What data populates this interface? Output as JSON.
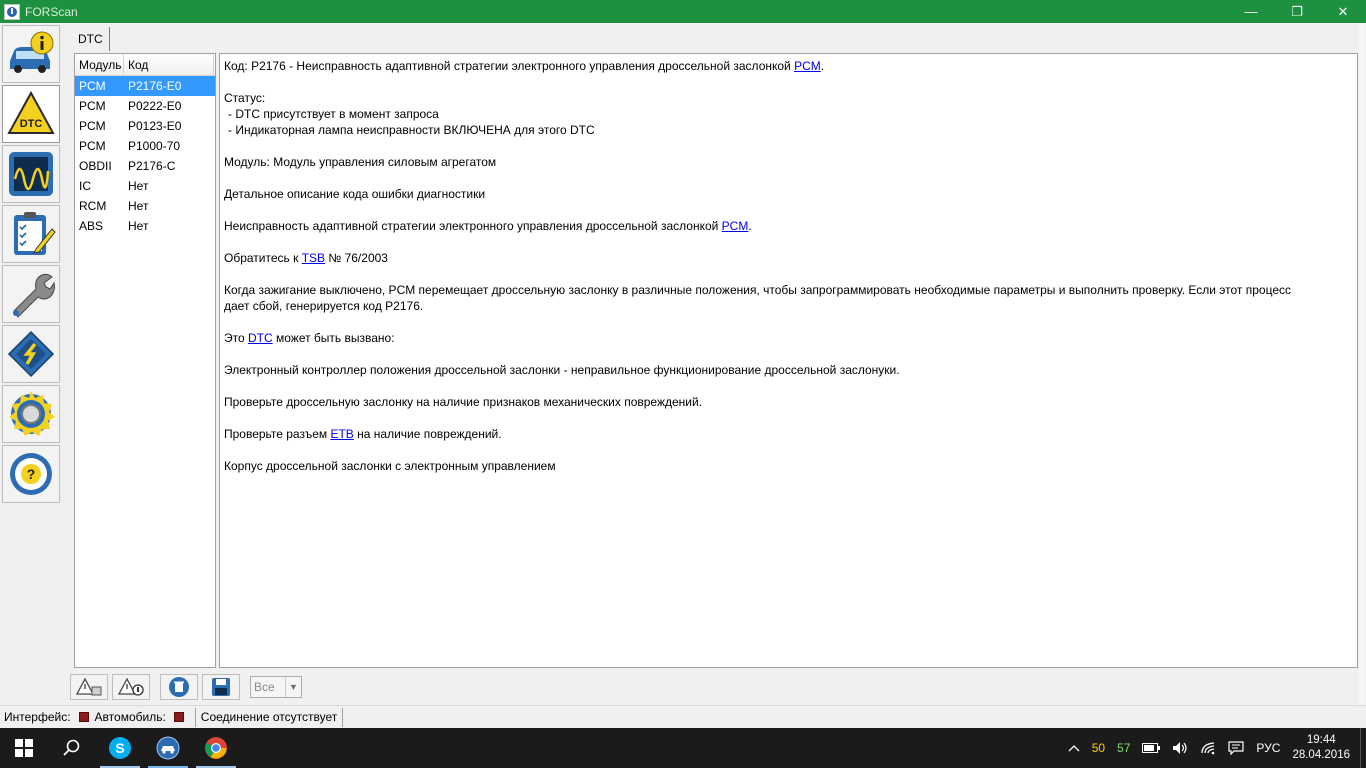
{
  "window": {
    "title": "FORScan",
    "minimize": "—",
    "maximize": "❐",
    "close": "✕"
  },
  "sidebar": {
    "items": [
      {
        "name": "vehicle-info",
        "icon": "car-info-icon"
      },
      {
        "name": "dtc",
        "icon": "dtc-warning-icon",
        "label": "DTC"
      },
      {
        "name": "oscilloscope",
        "icon": "oscilloscope-icon"
      },
      {
        "name": "tests",
        "icon": "checklist-icon"
      },
      {
        "name": "service",
        "icon": "wrench-icon"
      },
      {
        "name": "configuration",
        "icon": "chip-icon"
      },
      {
        "name": "settings",
        "icon": "gear-icon"
      },
      {
        "name": "help",
        "icon": "steering-help-icon"
      }
    ]
  },
  "tabs": [
    {
      "label": "DTC"
    }
  ],
  "dtc_table": {
    "headers": {
      "module": "Модуль",
      "code": "Код"
    },
    "rows": [
      {
        "module": "PCM",
        "code": "P2176-E0"
      },
      {
        "module": "PCM",
        "code": "P0222-E0"
      },
      {
        "module": "PCM",
        "code": "P0123-E0"
      },
      {
        "module": "PCM",
        "code": "P1000-70"
      },
      {
        "module": "OBDII",
        "code": "P2176-C"
      },
      {
        "module": "IC",
        "code": "Нет"
      },
      {
        "module": "RCM",
        "code": "Нет"
      },
      {
        "module": "ABS",
        "code": "Нет"
      }
    ],
    "selected_index": 0
  },
  "details": {
    "code_prefix": "Код: P2176 - Неисправность адаптивной стратегии электронного управления дроссельной заслонкой ",
    "code_link": "PCM",
    "code_suffix": ".",
    "status_label": "Статус:",
    "status_1": " - DTC присутствует в момент запроса",
    "status_2": " - Индикаторная лампа неисправности ВКЛЮЧЕНА для этого DTC",
    "module": "Модуль: Модуль управления силовым агрегатом",
    "detail_heading": "Детальное описание кода ошибки диагностики",
    "fault_prefix": "Неисправность адаптивной стратегии электронного управления дроссельной заслонкой ",
    "fault_link": "PCM",
    "fault_suffix": ".",
    "tsb_prefix": "Обратитесь к ",
    "tsb_link": "TSB",
    "tsb_suffix": " № 76/2003",
    "description": "Когда зажигание выключено, PCM перемещает дроссельную заслонку в различные положения, чтобы запрограммировать необходимые параметры и выполнить проверку. Если этот процесс дает сбой, генерируется код P2176.",
    "cause_prefix": "Это ",
    "cause_link": "DTC",
    "cause_suffix": " может быть вызвано:",
    "cause_1": "Электронный контроллер положения дроссельной заслонки - неправильное функционирование дроссельной заслонуки.",
    "cause_2": "Проверьте дроссельную заслонку на наличие признаков механических повреждений.",
    "cause_3_prefix": "Проверьте разъем ",
    "cause_3_link": "ETB",
    "cause_3_suffix": " на наличие повреждений.",
    "cause_4": "Корпус дроссельной заслонки с электронным управлением"
  },
  "toolbar": {
    "filter_value": "Все",
    "buttons": [
      "read-dtc-icon",
      "clear-dtc-icon",
      "delete-icon",
      "save-icon"
    ]
  },
  "statusbar": {
    "interface_label": "Интерфейс:",
    "vehicle_label": "Автомобиль:",
    "connection_text": "Соединение отсутствует",
    "led_color": "#8b1c1c"
  },
  "taskbar": {
    "tray_num_1": "50",
    "tray_num_2": "57",
    "language": "РУС",
    "time": "19:44",
    "date": "28.04.2016"
  },
  "colors": {
    "titlebar": "#1e9140",
    "selection": "#3399ff",
    "link": "#0000ee"
  }
}
